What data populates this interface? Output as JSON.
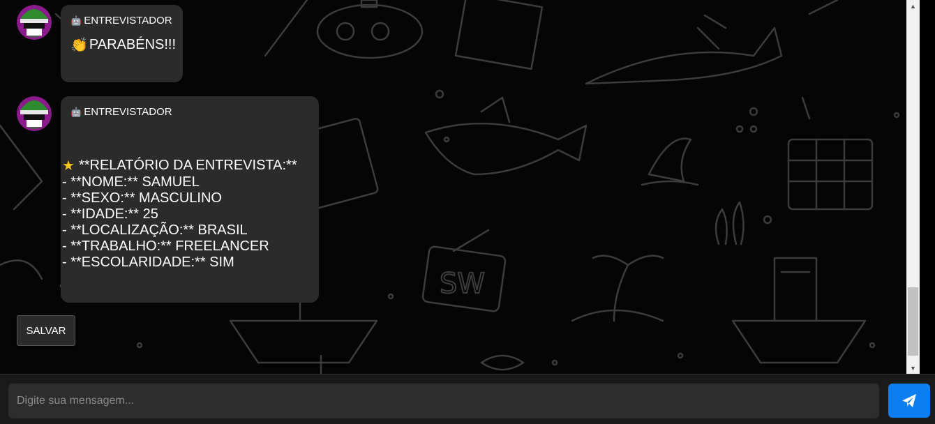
{
  "chat": {
    "messages": [
      {
        "sender": "ENTREVISTADOR",
        "sender_icon": "robot-icon",
        "icon": "clapping-hands-icon",
        "text": "PARABÉNS!!!"
      },
      {
        "sender": "ENTREVISTADOR",
        "sender_icon": "robot-icon",
        "title_icon": "star-icon",
        "title": "**RELATÓRIO DA ENTREVISTA:**",
        "lines": [
          "- **NOME:** SAMUEL",
          "- **SEXO:** MASCULINO",
          "- **IDADE:** 25",
          "- **LOCALIZAÇÃO:** BRASIL",
          "- **TRABALHO:** FREELANCER",
          "- **ESCOLARIDADE:** SIM"
        ]
      }
    ]
  },
  "actions": {
    "save_label": "SALVAR"
  },
  "input": {
    "placeholder": "Digite sua mensagem...",
    "value": "",
    "send_icon": "paper-plane-icon"
  },
  "colors": {
    "bubble": "#2b2b2b",
    "send_button": "#0d7ef2",
    "input_bg": "#2d2d2d",
    "avatar_helmet": "#2e8b2e",
    "avatar_purple": "#9b1d9b"
  }
}
